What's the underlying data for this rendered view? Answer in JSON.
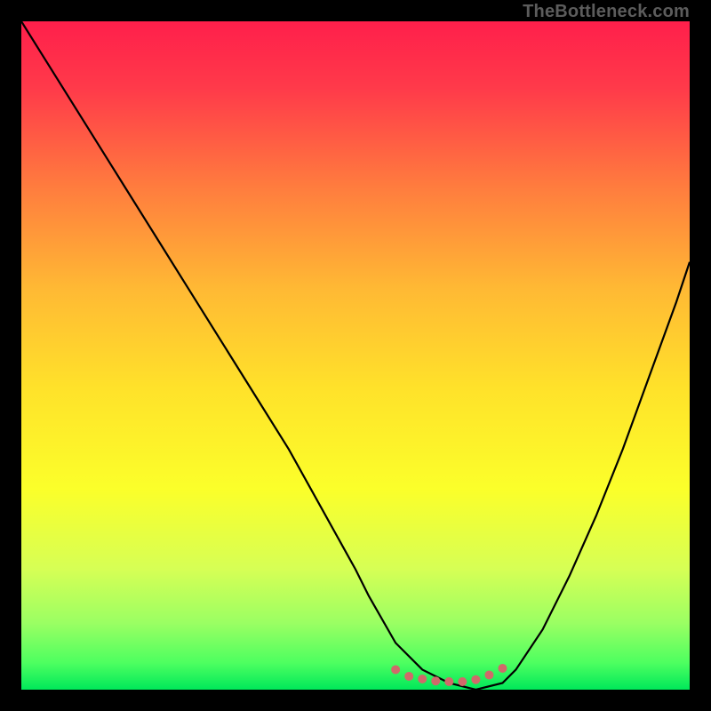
{
  "watermark": "TheBottleneck.com",
  "chart_data": {
    "type": "line",
    "title": "",
    "xlabel": "",
    "ylabel": "",
    "xlim": [
      0,
      100
    ],
    "ylim": [
      0,
      100
    ],
    "grid": false,
    "legend": false,
    "gradient_stops": [
      {
        "offset": 0.0,
        "color": "#ff1f4b"
      },
      {
        "offset": 0.1,
        "color": "#ff3a4a"
      },
      {
        "offset": 0.25,
        "color": "#ff7d3e"
      },
      {
        "offset": 0.4,
        "color": "#ffb934"
      },
      {
        "offset": 0.55,
        "color": "#ffe22a"
      },
      {
        "offset": 0.7,
        "color": "#fbff2a"
      },
      {
        "offset": 0.82,
        "color": "#d6ff55"
      },
      {
        "offset": 0.9,
        "color": "#9bff63"
      },
      {
        "offset": 0.96,
        "color": "#4dff60"
      },
      {
        "offset": 1.0,
        "color": "#00e85a"
      }
    ],
    "series": [
      {
        "name": "bottleneck-curve",
        "color": "#000000",
        "x": [
          0,
          5,
          10,
          15,
          20,
          25,
          30,
          35,
          40,
          45,
          50,
          52,
          56,
          60,
          64,
          68,
          72,
          74,
          78,
          82,
          86,
          90,
          94,
          98,
          100
        ],
        "values": [
          100,
          92,
          84,
          76,
          68,
          60,
          52,
          44,
          36,
          27,
          18,
          14,
          7,
          3,
          1,
          0,
          1,
          3,
          9,
          17,
          26,
          36,
          47,
          58,
          64
        ]
      },
      {
        "name": "optimal-range-marker",
        "type": "scatter",
        "color": "#d06a6a",
        "x": [
          56,
          58,
          60,
          62,
          64,
          66,
          68,
          70,
          72
        ],
        "values": [
          3,
          2,
          1.6,
          1.3,
          1.2,
          1.2,
          1.5,
          2.2,
          3.2
        ]
      }
    ]
  }
}
